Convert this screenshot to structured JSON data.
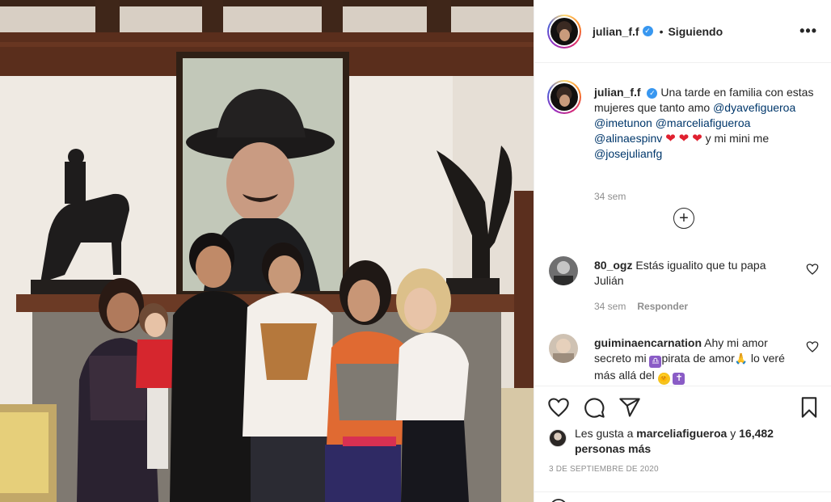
{
  "post": {
    "username": "julian_f.f",
    "verified_mark": "✓",
    "separator": "•",
    "follow_state": "Siguiendo",
    "more_label": "•••",
    "photo_description_icon": "family-photo"
  },
  "caption": {
    "username": "julian_f.f",
    "text_1": "Una tarde en familia con estas mujeres que tanto amo",
    "mention_1": "@dyavefigueroa",
    "mention_2": "@imetunon",
    "mention_3": "@marceliafigueroa",
    "mention_4": "@alinaespinv",
    "hearts": "❤",
    "text_2": "y mi mini me",
    "mention_5": "@josejulianfg",
    "time": "34 sem"
  },
  "load_more_label": "+",
  "comments": [
    {
      "username": "80_ogz",
      "text": "Estás igualito que tu papa Julián",
      "time": "34 sem",
      "reply": "Responder"
    },
    {
      "username": "guiminaencarnation",
      "text_1": "Ahy mi amor secreto mi",
      "libra": "♎",
      "text_2": "pirata de amor",
      "pray": "🙏",
      "text_3": "lo veré más allá del",
      "sun": "🌞",
      "cross": "✝"
    }
  ],
  "likes": {
    "prefix": "Les gusta a",
    "user": "marceliafigueroa",
    "conj": "y",
    "count": "16,482 personas más"
  },
  "date": "3 DE SEPTIEMBRE DE 2020",
  "icons": {
    "like": "heart-icon",
    "comment": "comment-icon",
    "share": "share-icon",
    "save": "bookmark-icon"
  },
  "colors": {
    "mention": "#00376b",
    "verified": "#3897f0",
    "muted": "#8e8e8e"
  }
}
